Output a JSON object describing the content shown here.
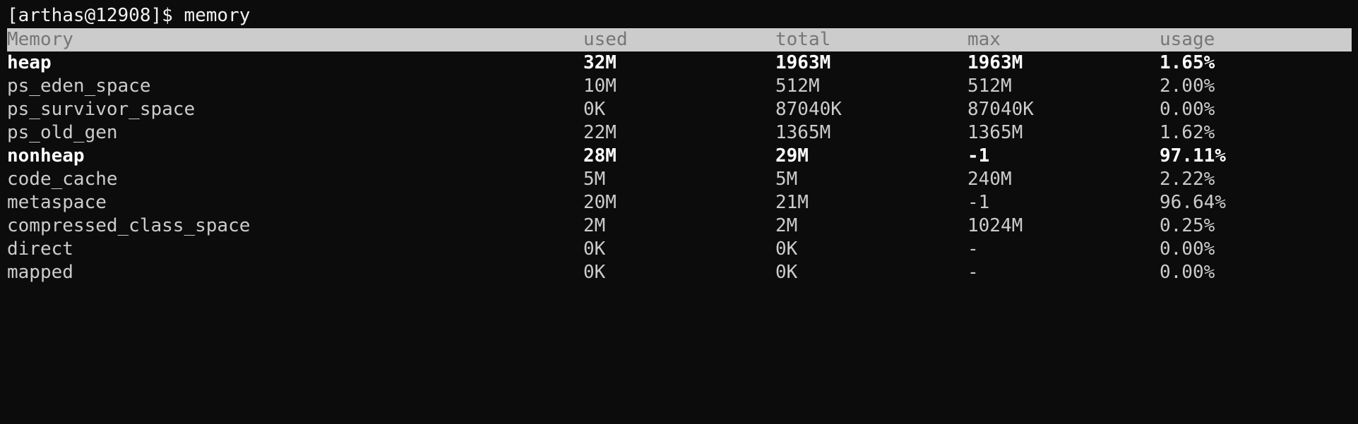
{
  "terminal": {
    "prompt": "[arthas@12908]$ memory"
  },
  "table": {
    "headers": [
      "Memory",
      "used",
      "total",
      "max",
      "usage"
    ],
    "rows": [
      {
        "cells": [
          "heap",
          "32M",
          "1963M",
          "1963M",
          "1.65%"
        ],
        "bold": true
      },
      {
        "cells": [
          "ps_eden_space",
          "10M",
          "512M",
          "512M",
          "2.00%"
        ],
        "bold": false
      },
      {
        "cells": [
          "ps_survivor_space",
          "0K",
          "87040K",
          "87040K",
          "0.00%"
        ],
        "bold": false
      },
      {
        "cells": [
          "ps_old_gen",
          "22M",
          "1365M",
          "1365M",
          "1.62%"
        ],
        "bold": false
      },
      {
        "cells": [
          "nonheap",
          "28M",
          "29M",
          "-1",
          "97.11%"
        ],
        "bold": true
      },
      {
        "cells": [
          "code_cache",
          "5M",
          "5M",
          "240M",
          "2.22%"
        ],
        "bold": false
      },
      {
        "cells": [
          "metaspace",
          "20M",
          "21M",
          "-1",
          "96.64%"
        ],
        "bold": false
      },
      {
        "cells": [
          "compressed_class_space",
          "2M",
          "2M",
          "1024M",
          "0.25%"
        ],
        "bold": false
      },
      {
        "cells": [
          "direct",
          "0K",
          "0K",
          "-",
          "0.00%"
        ],
        "bold": false
      },
      {
        "cells": [
          "mapped",
          "0K",
          "0K",
          "-",
          "0.00%"
        ],
        "bold": false
      }
    ]
  },
  "colors": {
    "background": "#0c0c0c",
    "text": "#cccccc",
    "bold_text": "#ffffff",
    "header_background": "#cccccc",
    "header_text": "#767676"
  }
}
